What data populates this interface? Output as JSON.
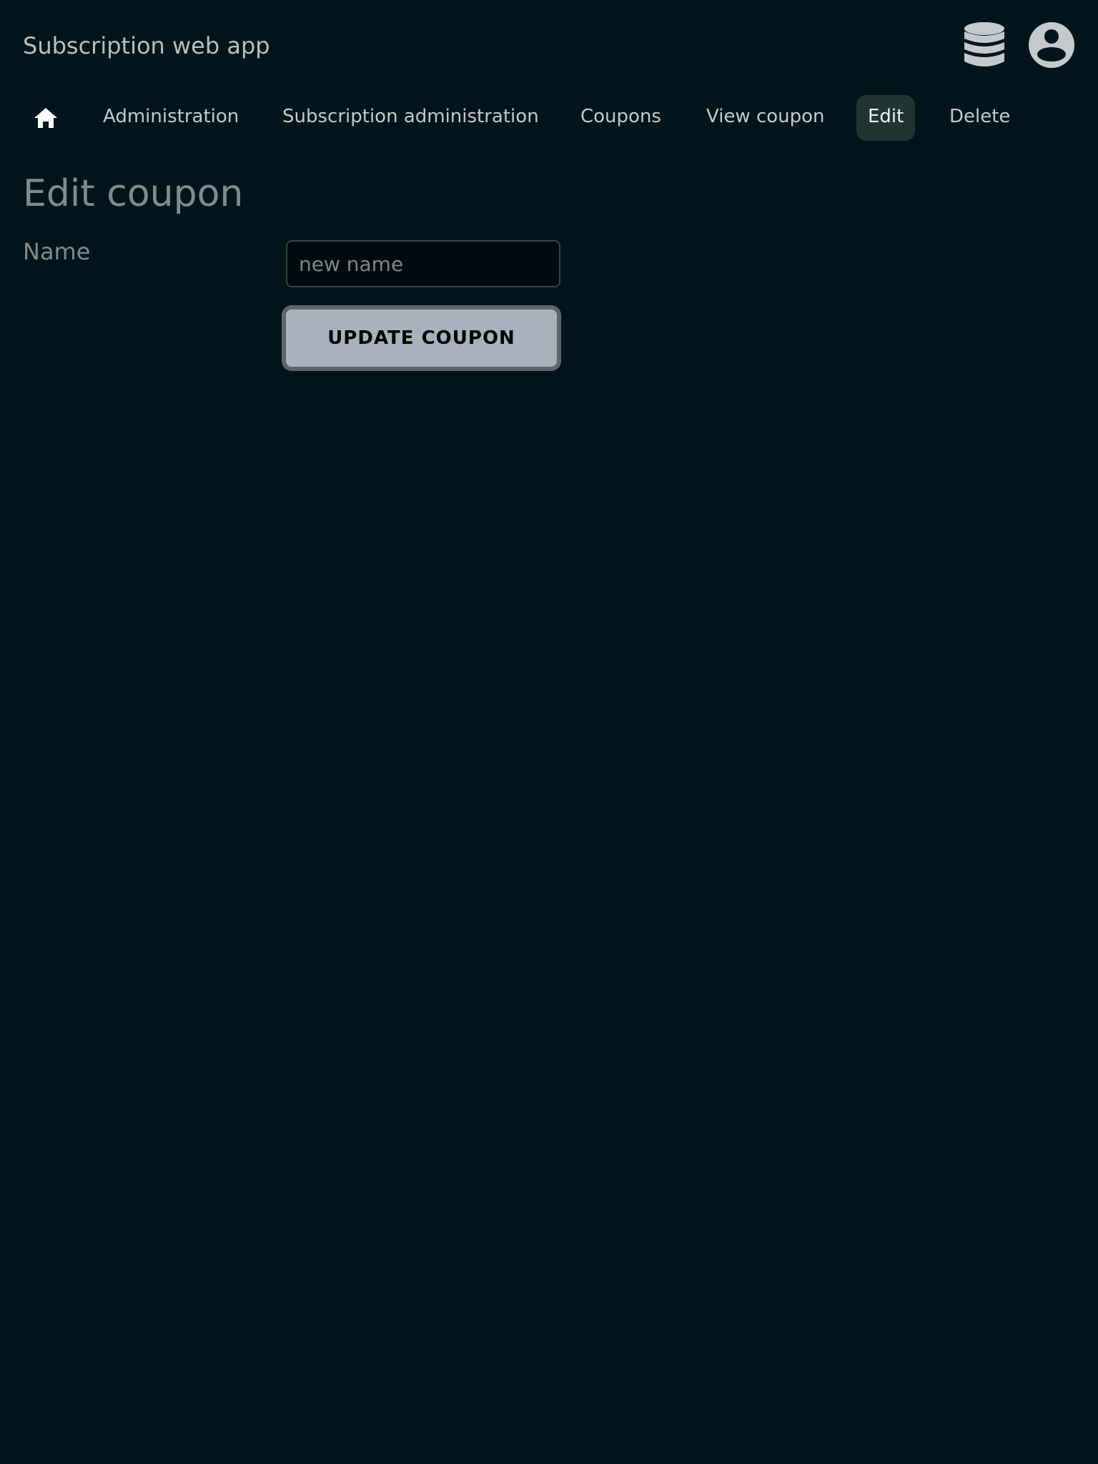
{
  "header": {
    "app_title": "Subscription web app",
    "icons": [
      "database-icon",
      "account-circle-icon"
    ]
  },
  "nav": {
    "home_icon": "home-icon",
    "items": [
      {
        "label": "Administration",
        "active": false
      },
      {
        "label": "Subscription administration",
        "active": false
      },
      {
        "label": "Coupons",
        "active": false
      },
      {
        "label": "View coupon",
        "active": false
      },
      {
        "label": "Edit",
        "active": true
      },
      {
        "label": "Delete",
        "active": false
      }
    ]
  },
  "main": {
    "title": "Edit coupon",
    "name_label": "Name",
    "name_value": "",
    "name_placeholder": "new name",
    "submit_label": "UPDATE COUPON"
  },
  "colors": {
    "background": "#00141b",
    "active_tab_bg": "#203432",
    "button_bg": "#a7b2bd"
  }
}
